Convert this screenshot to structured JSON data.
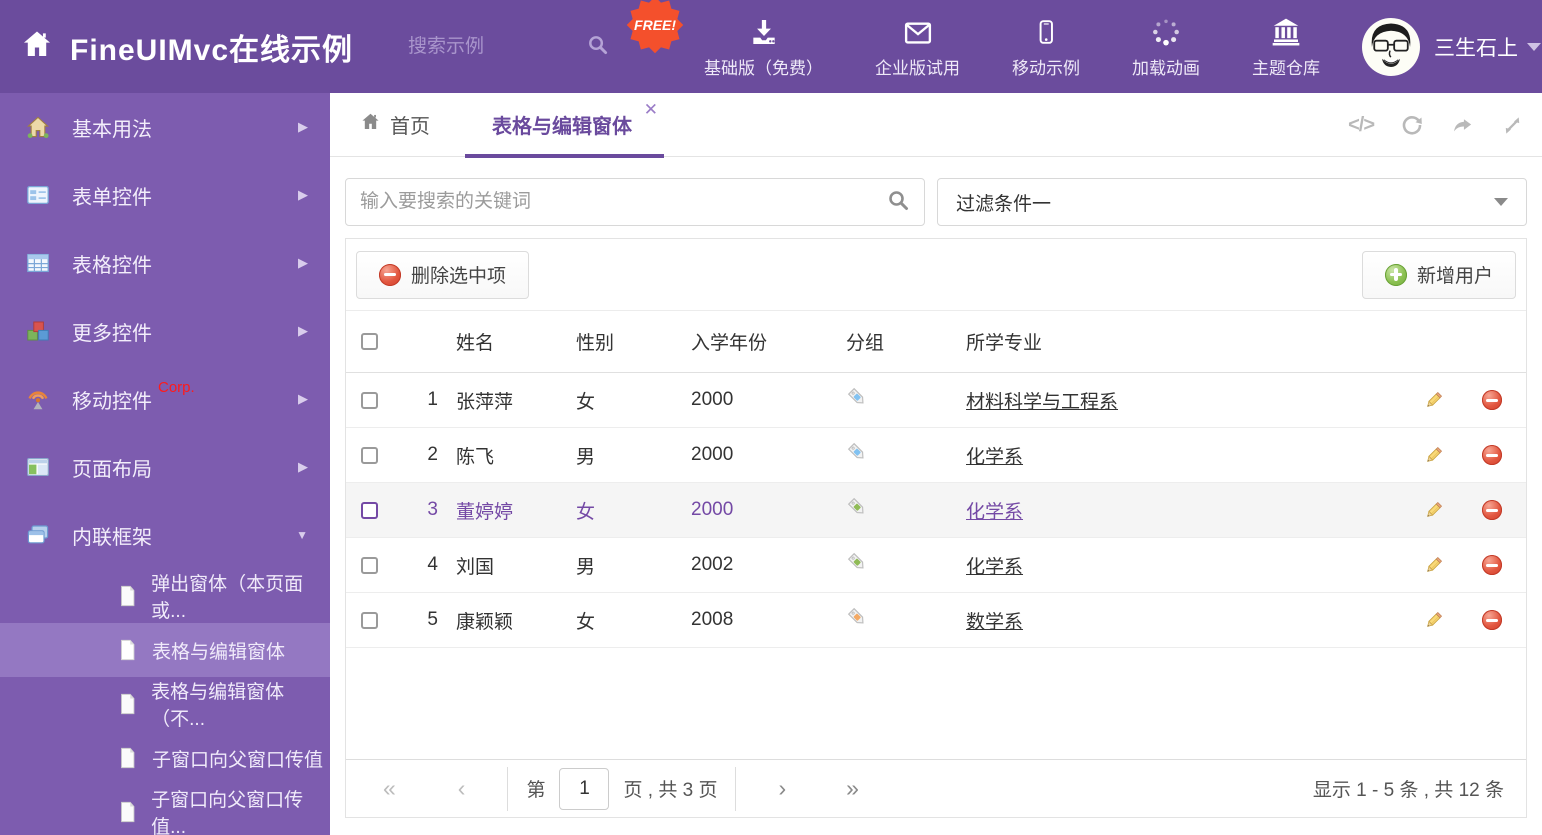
{
  "theme": {
    "header_bg": "#6b4c9d",
    "sidebar_bg": "#7d5caf",
    "sidebar_selected_bg": "#9478c2",
    "accent_purple": "#6a4a9d",
    "selected_row_text": "#7449a5",
    "free_badge_red": "#f4502c",
    "delete_red": "#dd4b39",
    "add_green": "#7ab648"
  },
  "header": {
    "title": "FineUIMvc在线示例",
    "search_placeholder": "搜索示例",
    "free_badge": "FREE!",
    "nav_items": [
      {
        "label": "基础版（免费）",
        "icon": "download-icon"
      },
      {
        "label": "企业版试用",
        "icon": "envelope-icon"
      },
      {
        "label": "移动示例",
        "icon": "mobile-icon"
      },
      {
        "label": "加载动画",
        "icon": "spinner-icon"
      },
      {
        "label": "主题仓库",
        "icon": "bank-icon"
      }
    ],
    "username": "三生石上"
  },
  "sidebar": {
    "items": [
      {
        "label": "基本用法"
      },
      {
        "label": "表单控件"
      },
      {
        "label": "表格控件"
      },
      {
        "label": "更多控件"
      },
      {
        "label": "移动控件",
        "badge": "Corp."
      },
      {
        "label": "页面布局"
      },
      {
        "label": "内联框架"
      }
    ],
    "subitems": [
      {
        "label": "弹出窗体（本页面或..."
      },
      {
        "label": "表格与编辑窗体"
      },
      {
        "label": "表格与编辑窗体（不..."
      },
      {
        "label": "子窗口向父窗口传值"
      },
      {
        "label": "子窗口向父窗口传值..."
      }
    ]
  },
  "tabs": {
    "home": "首页",
    "active": "表格与编辑窗体"
  },
  "filter": {
    "search_placeholder": "输入要搜索的关键词",
    "dropdown_value": "过滤条件一"
  },
  "grid": {
    "delete_button": "删除选中项",
    "add_button": "新增用户",
    "columns": {
      "name": "姓名",
      "gender": "性别",
      "year": "入学年份",
      "group": "分组",
      "major": "所学专业"
    },
    "rows": [
      {
        "num": "1",
        "name": "张萍萍",
        "gender": "女",
        "year": "2000",
        "tag_color": "#82c2f1",
        "major": "材料科学与工程系"
      },
      {
        "num": "2",
        "name": "陈飞",
        "gender": "男",
        "year": "2000",
        "tag_color": "#82c2f1",
        "major": "化学系"
      },
      {
        "num": "3",
        "name": "董婷婷",
        "gender": "女",
        "year": "2000",
        "tag_color": "#90bb57",
        "major": "化学系"
      },
      {
        "num": "4",
        "name": "刘国",
        "gender": "男",
        "year": "2002",
        "tag_color": "#90bb57",
        "major": "化学系"
      },
      {
        "num": "5",
        "name": "康颖颖",
        "gender": "女",
        "year": "2008",
        "tag_color": "#f3a964",
        "major": "数学系"
      }
    ]
  },
  "pagination": {
    "label_page": "第",
    "page_value": "1",
    "label_total": "页 , 共 3 页",
    "summary": "显示 1 - 5 条 , 共 12 条"
  }
}
